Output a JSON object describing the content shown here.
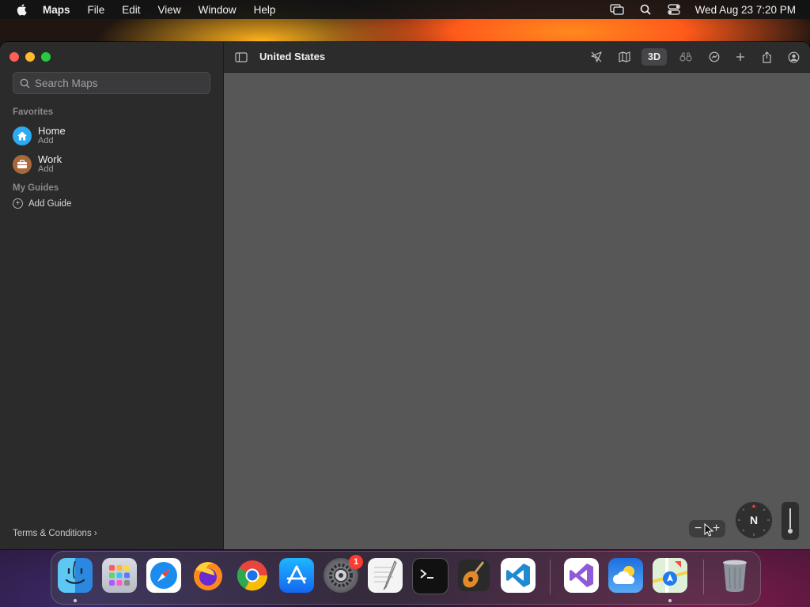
{
  "menubar": {
    "app_name": "Maps",
    "menus": [
      "File",
      "Edit",
      "View",
      "Window",
      "Help"
    ],
    "clock": "Wed Aug 23  7:20 PM"
  },
  "window": {
    "title": "United States",
    "search_placeholder": "Search Maps",
    "favorites_label": "Favorites",
    "favorites": [
      {
        "title": "Home",
        "sub": "Add",
        "icon": "house-icon",
        "color": "#2eaaf0"
      },
      {
        "title": "Work",
        "sub": "Add",
        "icon": "briefcase-icon",
        "color": "#a8683a"
      }
    ],
    "guides_label": "My Guides",
    "add_guide": "Add Guide",
    "terms": "Terms & Conditions",
    "toolbar": {
      "view_3d": "3D",
      "icons": [
        "sidebar-toggle-icon",
        "location-arrow-icon",
        "map-mode-icon",
        "3d-button",
        "binoculars-icon",
        "time-icon",
        "add-icon",
        "share-icon",
        "account-icon"
      ]
    },
    "compass_label": "N"
  },
  "dock": {
    "apps": [
      "Finder",
      "Launchpad",
      "Safari",
      "Firefox",
      "Chrome",
      "App Store",
      "System Settings",
      "TextEdit",
      "Terminal",
      "GarageBand",
      "Visual Studio Code",
      "Visual Studio",
      "Weather",
      "Maps",
      "Trash"
    ],
    "settings_badge": "1"
  },
  "colors": {
    "map_bg": "#575757",
    "sidebar_bg": "#2b2b2c",
    "accent_red": "#fe5f57",
    "accent_yellow": "#febc2e",
    "accent_green": "#28c840"
  }
}
